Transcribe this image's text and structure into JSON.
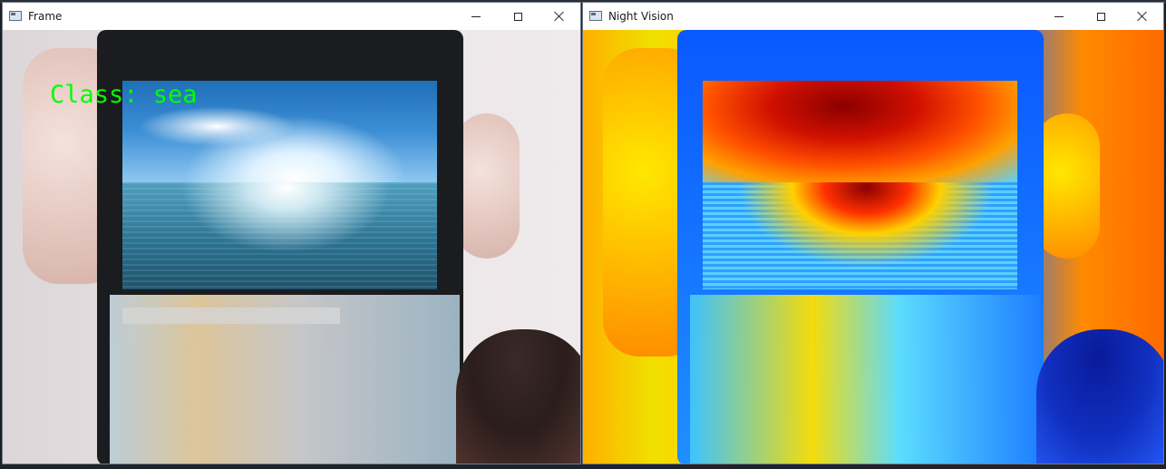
{
  "windows": {
    "frame": {
      "title": "Frame",
      "overlay_label": "Class: sea",
      "overlay_color": "#00ff00"
    },
    "night_vision": {
      "title": "Night Vision"
    }
  },
  "window_controls": {
    "minimize_icon": "minimize-icon",
    "maximize_icon": "maximize-icon",
    "close_icon": "close-icon"
  }
}
